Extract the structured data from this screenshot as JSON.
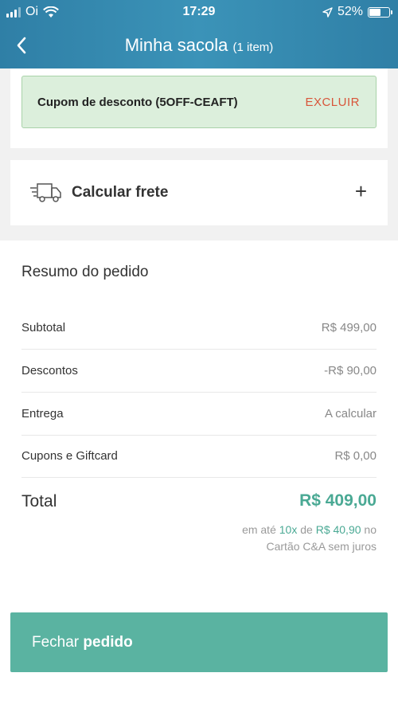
{
  "status_bar": {
    "carrier": "Oi",
    "time": "17:29",
    "battery_percent": "52%"
  },
  "header": {
    "title": "Minha sacola",
    "item_count": "(1 item)"
  },
  "coupon": {
    "label": "Cupom de desconto (5OFF-CEAFT)",
    "delete_label": "EXCLUIR"
  },
  "shipping": {
    "label": "Calcular frete",
    "expand_symbol": "+"
  },
  "summary": {
    "title": "Resumo do pedido",
    "rows": [
      {
        "label": "Subtotal",
        "value": "R$ 499,00"
      },
      {
        "label": "Descontos",
        "value": "-R$ 90,00"
      },
      {
        "label": "Entrega",
        "value": "A calcular"
      },
      {
        "label": "Cupons e Giftcard",
        "value": "R$ 0,00"
      }
    ],
    "total_label": "Total",
    "total_value": "R$ 409,00",
    "installment": {
      "prefix": "em até",
      "count": "10x",
      "mid": "de",
      "amount": "R$ 40,90",
      "suffix": "no",
      "line2": "Cartão C&A sem juros"
    }
  },
  "checkout": {
    "prefix": "Fechar",
    "bold": "pedido"
  },
  "colors": {
    "header": "#3b93b8",
    "accent_green": "#4aa994",
    "cta": "#5ab3a1",
    "delete_red": "#d8553a",
    "coupon_bg": "#dcefdc"
  }
}
